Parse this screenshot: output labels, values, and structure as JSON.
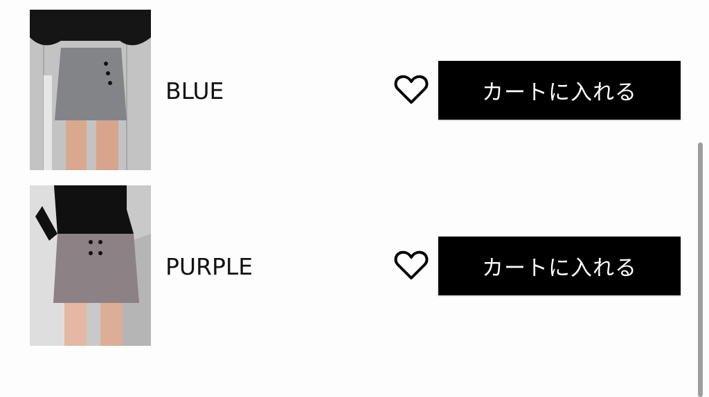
{
  "items": [
    {
      "color": "BLUE",
      "cart_label": "カートに入れる",
      "favorite_icon": "heart-outline-icon"
    },
    {
      "color": "PURPLE",
      "cart_label": "カートに入れる",
      "favorite_icon": "heart-outline-icon"
    }
  ],
  "colors": {
    "button_bg": "#000000",
    "button_text": "#ffffff",
    "label_text": "#111111",
    "background": "#fdfdfd"
  }
}
